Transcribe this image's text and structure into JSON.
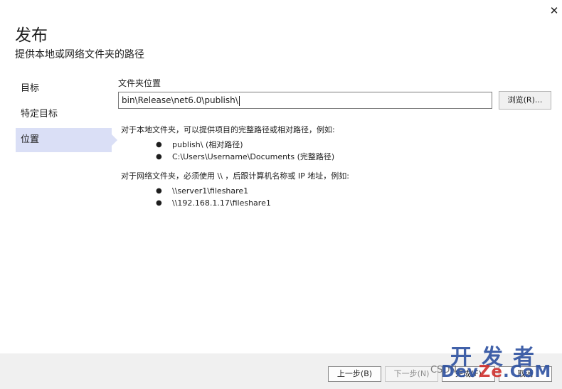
{
  "window": {
    "title": "发布",
    "subtitle": "提供本地或网络文件夹的路径",
    "close_glyph": "✕"
  },
  "nav": {
    "items": [
      {
        "label": "目标",
        "active": false
      },
      {
        "label": "特定目标",
        "active": false
      },
      {
        "label": "位置",
        "active": true
      }
    ]
  },
  "folder": {
    "label": "文件夹位置",
    "value": "bin\\Release\\net6.0\\publish\\",
    "browse_label": "浏览(R)..."
  },
  "help": {
    "local_intro": "对于本地文件夹，可以提供项目的完整路径或相对路径，例如:",
    "local_examples": [
      "publish\\ (相对路径)",
      "C:\\Users\\Username\\Documents (完整路径)"
    ],
    "network_intro": "对于网络文件夹，必须使用 \\\\ ，后跟计算机名称或 IP 地址，例如:",
    "network_examples": [
      "\\\\server1\\fileshare1",
      "\\\\192.168.1.17\\fileshare1"
    ],
    "bullet": "●"
  },
  "footer": {
    "prev_label": "上一步(B)",
    "next_label": "下一步(N)",
    "finish_label": "完成(F)",
    "cancel_label": "取消"
  },
  "watermark": {
    "line1": "开发者",
    "line2": "CSDN",
    "line3a": "Dev",
    "line3b": "Ze",
    "line3c": ".CoM"
  },
  "colors": {
    "active_nav": "#dadff6",
    "footer_bg": "#f0f0f0",
    "watermark_blue": "#2d51a0",
    "watermark_red": "#d0312d"
  }
}
